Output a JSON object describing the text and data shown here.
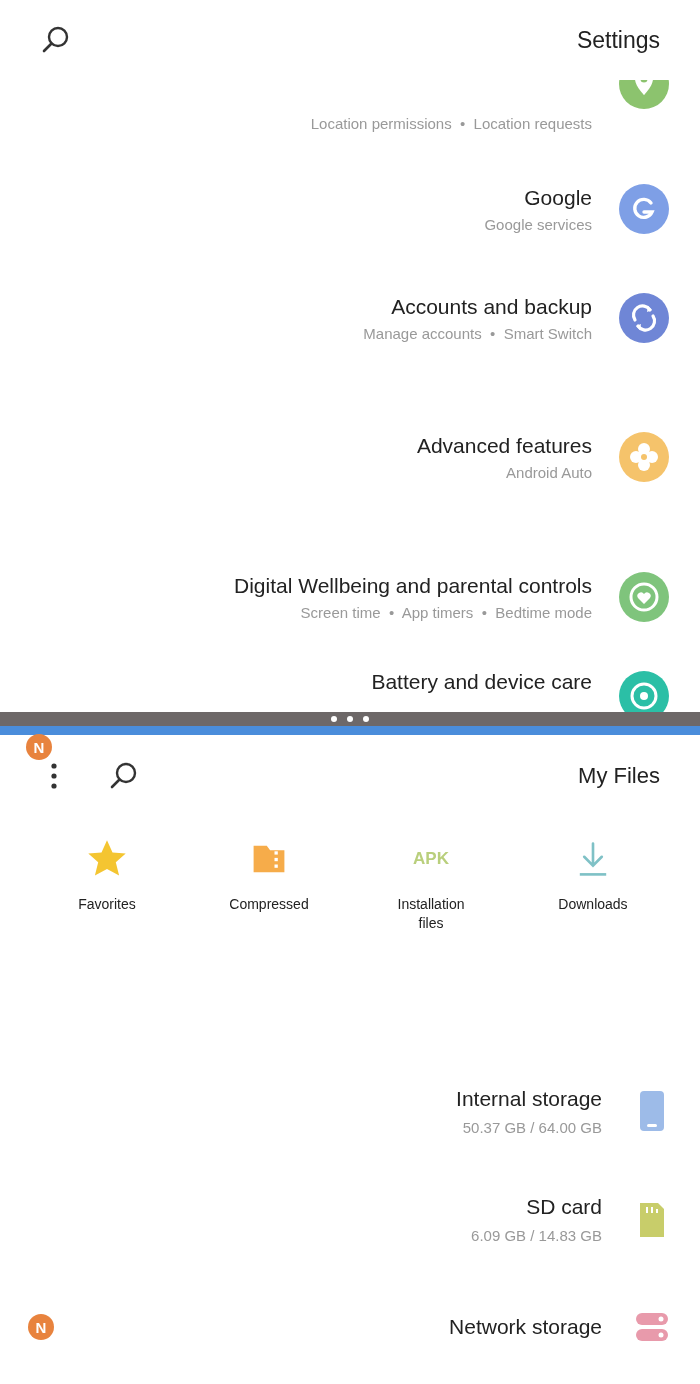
{
  "settings": {
    "title": "Settings",
    "items": [
      {
        "kind": "location",
        "subtitle": "Location permissions  •  Location requests"
      },
      {
        "kind": "google",
        "title": "Google",
        "subtitle": "Google services"
      },
      {
        "kind": "sync",
        "title": "Accounts and backup",
        "subtitle": "Manage accounts  •  Smart Switch"
      },
      {
        "kind": "gear",
        "title": "Advanced features",
        "subtitle": "Android Auto"
      },
      {
        "kind": "heart",
        "title": "Digital Wellbeing and parental controls",
        "subtitle": "Screen time  •  App timers  •  Bedtime mode"
      },
      {
        "kind": "battery",
        "title": "Battery and device care"
      }
    ]
  },
  "files": {
    "badge": "N",
    "title": "My Files",
    "categories": [
      {
        "kind": "star",
        "label": "Favorites"
      },
      {
        "kind": "folder",
        "label": "Compressed"
      },
      {
        "kind": "apk",
        "icon_text": "APK",
        "label": "Installation files"
      },
      {
        "kind": "download",
        "label": "Downloads"
      }
    ],
    "storage": [
      {
        "kind": "phone",
        "title": "Internal storage",
        "detail": "50.37 GB / 64.00 GB"
      },
      {
        "kind": "sd",
        "title": "SD card",
        "detail": "6.09 GB / 14.83 GB"
      },
      {
        "kind": "network",
        "badge": "N",
        "title": "Network storage"
      }
    ]
  }
}
